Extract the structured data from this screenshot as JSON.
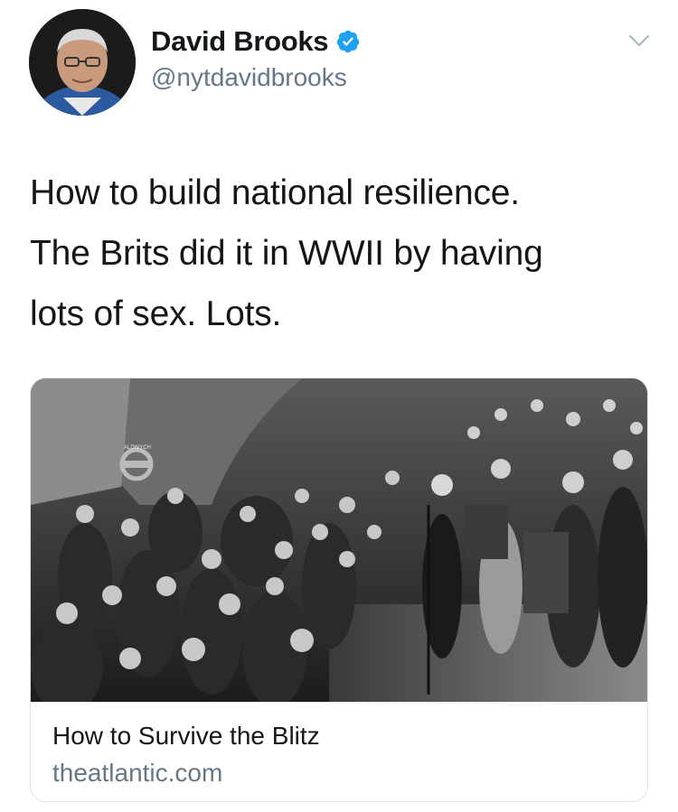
{
  "tweet": {
    "author_name": "David Brooks",
    "handle": "@nytdavidbrooks",
    "verified": true,
    "text_lines": [
      "How to build national resilience.",
      "The Brits did it in WWII by having",
      "lots of sex. Lots."
    ]
  },
  "link_card": {
    "title": "How to Survive the Blitz",
    "domain": "theatlantic.com",
    "image_description_icon": "photo-crowd-underground-shelter",
    "sign_text": "ALDWYCH"
  },
  "colors": {
    "verified_blue": "#1da1f2",
    "secondary_text": "#657786",
    "primary_text": "#14171a",
    "card_border": "#dfe3e8"
  },
  "icons": {
    "verified": "verified-badge-icon",
    "more": "chevron-down-icon"
  }
}
